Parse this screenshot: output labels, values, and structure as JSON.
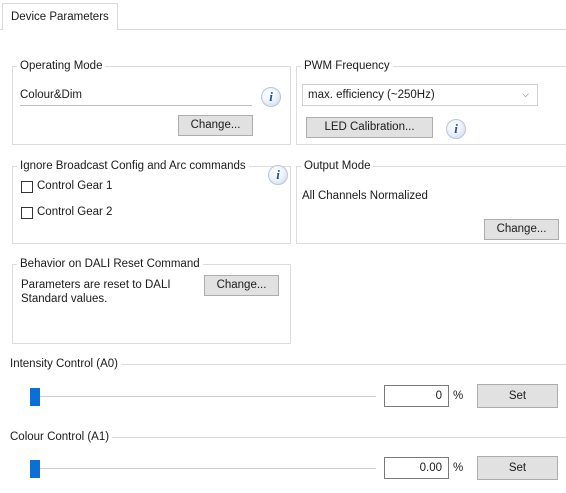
{
  "tab": {
    "label": "Device Parameters"
  },
  "operating_mode": {
    "legend": "Operating Mode",
    "value": "Colour&Dim",
    "info_glyph": "i",
    "change_label": "Change..."
  },
  "pwm_frequency": {
    "legend": "PWM Frequency",
    "selected": "max. efficiency (~250Hz)",
    "caret_glyph": "⌵",
    "led_calibration_label": "LED Calibration...",
    "info_glyph": "i"
  },
  "ignore_broadcast": {
    "legend": "Ignore Broadcast Config and Arc commands",
    "info_glyph": "i",
    "items": [
      {
        "label": "Control Gear 1",
        "checked": false
      },
      {
        "label": "Control Gear 2",
        "checked": false
      }
    ]
  },
  "output_mode": {
    "legend": "Output Mode",
    "value": "All Channels Normalized",
    "change_label": "Change..."
  },
  "dali_reset": {
    "legend": "Behavior on DALI Reset Command",
    "description": "Parameters are reset to DALI Standard values.",
    "change_label": "Change..."
  },
  "intensity_control": {
    "legend": "Intensity Control (A0)",
    "value": "0",
    "unit": "%",
    "level": 0,
    "set_label": "Set"
  },
  "colour_control": {
    "legend": "Colour Control (A1)",
    "value": "0.00",
    "unit": "%",
    "level": 0,
    "set_label": "Set"
  },
  "colors": {
    "accent": "#0a6fd6",
    "border": "#dcdcdc",
    "button_bg": "#e1e1e1"
  }
}
